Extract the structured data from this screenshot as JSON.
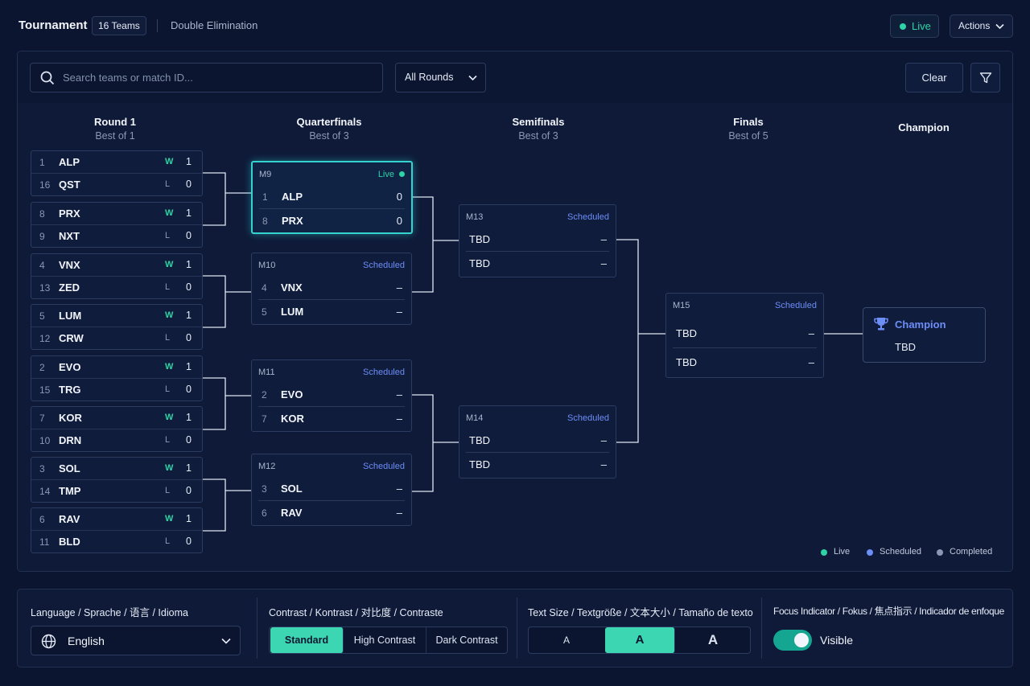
{
  "header": {
    "title": "Tournament",
    "teams_pill": "16 Teams",
    "format": "Double Elimination",
    "live_label": "Live",
    "actions_label": "Actions"
  },
  "toolbar": {
    "search_placeholder": "Search teams or match ID...",
    "rounds_select": "All Rounds",
    "clear_label": "Clear"
  },
  "rounds": [
    {
      "name": "Round 1",
      "best_of": "Best of 1"
    },
    {
      "name": "Quarterfinals",
      "best_of": "Best of 3"
    },
    {
      "name": "Semifinals",
      "best_of": "Best of 3"
    },
    {
      "name": "Finals",
      "best_of": "Best of 5"
    },
    {
      "name": "Champion"
    }
  ],
  "round1": [
    {
      "a": {
        "seed": "1",
        "team": "ALP",
        "result": "W",
        "score": "1"
      },
      "b": {
        "seed": "16",
        "team": "QST",
        "result": "L",
        "score": "0"
      }
    },
    {
      "a": {
        "seed": "8",
        "team": "PRX",
        "result": "W",
        "score": "1"
      },
      "b": {
        "seed": "9",
        "team": "NXT",
        "result": "L",
        "score": "0"
      }
    },
    {
      "a": {
        "seed": "4",
        "team": "VNX",
        "result": "W",
        "score": "1"
      },
      "b": {
        "seed": "13",
        "team": "ZED",
        "result": "L",
        "score": "0"
      }
    },
    {
      "a": {
        "seed": "5",
        "team": "LUM",
        "result": "W",
        "score": "1"
      },
      "b": {
        "seed": "12",
        "team": "CRW",
        "result": "L",
        "score": "0"
      }
    },
    {
      "a": {
        "seed": "2",
        "team": "EVO",
        "result": "W",
        "score": "1"
      },
      "b": {
        "seed": "15",
        "team": "TRG",
        "result": "L",
        "score": "0"
      }
    },
    {
      "a": {
        "seed": "7",
        "team": "KOR",
        "result": "W",
        "score": "1"
      },
      "b": {
        "seed": "10",
        "team": "DRN",
        "result": "L",
        "score": "0"
      }
    },
    {
      "a": {
        "seed": "3",
        "team": "SOL",
        "result": "W",
        "score": "1"
      },
      "b": {
        "seed": "14",
        "team": "TMP",
        "result": "L",
        "score": "0"
      }
    },
    {
      "a": {
        "seed": "6",
        "team": "RAV",
        "result": "W",
        "score": "1"
      },
      "b": {
        "seed": "11",
        "team": "BLD",
        "result": "L",
        "score": "0"
      }
    }
  ],
  "quarterfinals": [
    {
      "id": "M9",
      "status": "Live",
      "a": {
        "seed": "1",
        "team": "ALP",
        "score": "0"
      },
      "b": {
        "seed": "8",
        "team": "PRX",
        "score": "0"
      }
    },
    {
      "id": "M10",
      "status": "Scheduled",
      "a": {
        "seed": "4",
        "team": "VNX",
        "score": "–"
      },
      "b": {
        "seed": "5",
        "team": "LUM",
        "score": "–"
      }
    },
    {
      "id": "M11",
      "status": "Scheduled",
      "a": {
        "seed": "2",
        "team": "EVO",
        "score": "–"
      },
      "b": {
        "seed": "7",
        "team": "KOR",
        "score": "–"
      }
    },
    {
      "id": "M12",
      "status": "Scheduled",
      "a": {
        "seed": "3",
        "team": "SOL",
        "score": "–"
      },
      "b": {
        "seed": "6",
        "team": "RAV",
        "score": "–"
      }
    }
  ],
  "semifinals": [
    {
      "id": "M13",
      "status": "Scheduled",
      "a": {
        "team": "TBD",
        "score": "–"
      },
      "b": {
        "team": "TBD",
        "score": "–"
      }
    },
    {
      "id": "M14",
      "status": "Scheduled",
      "a": {
        "team": "TBD",
        "score": "–"
      },
      "b": {
        "team": "TBD",
        "score": "–"
      }
    }
  ],
  "finals": {
    "id": "M15",
    "status": "Scheduled",
    "a": {
      "team": "TBD",
      "score": "–"
    },
    "b": {
      "team": "TBD",
      "score": "–"
    }
  },
  "champion": {
    "label": "Champion",
    "team": "TBD",
    "icon": "trophy-icon"
  },
  "legend": [
    {
      "label": "Live",
      "color": "#2ed3a6"
    },
    {
      "label": "Scheduled",
      "color": "#6d8df7"
    },
    {
      "label": "Completed",
      "color": "#8b98b3"
    }
  ],
  "settings": {
    "language": {
      "label": "Language / Sprache / 语言 / Idioma",
      "value": "English"
    },
    "contrast": {
      "label": "Contrast / Kontrast / 对比度 / Contraste",
      "options": [
        "Standard",
        "High Contrast",
        "Dark Contrast"
      ],
      "selected": "Standard"
    },
    "text_size": {
      "label": "Text Size / Textgröße / 文本大小 / Tamaño de texto",
      "options": [
        "A",
        "A",
        "A"
      ],
      "selected_index": 1
    },
    "focus": {
      "label": "Focus Indicator / Fokus / 焦点指示 / Indicador de enfoque",
      "value": "Visible",
      "on": true
    }
  },
  "colors": {
    "accent": "#2ed3a6",
    "live_border": "#35d3cf",
    "scheduled": "#6d8df7",
    "background": "#0b1530"
  }
}
